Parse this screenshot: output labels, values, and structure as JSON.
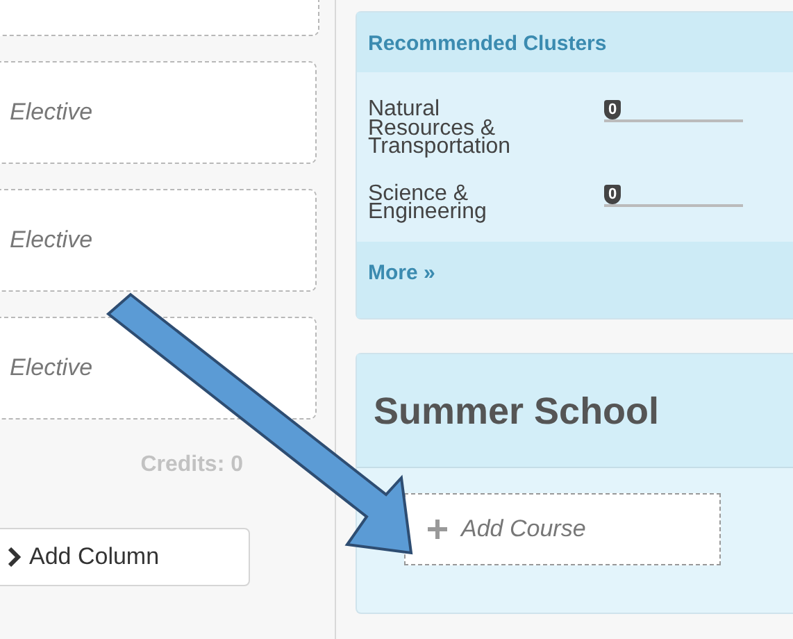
{
  "courses": [
    {
      "label": "Elective"
    },
    {
      "label": "Elective"
    },
    {
      "label": "Elective"
    }
  ],
  "credits": "Credits: 0",
  "add_column": {
    "label": "Add Column"
  },
  "recommended": {
    "title": "Recommended Clusters",
    "clusters": [
      {
        "name": "Natural\nResources &\nTransportation",
        "value": "0",
        "level": 0
      },
      {
        "name": "Science &\nEngineering",
        "value": "0",
        "level": 0
      }
    ],
    "more": "More »"
  },
  "summer_school": {
    "title": "Summer School",
    "add_course": "Add Course"
  }
}
